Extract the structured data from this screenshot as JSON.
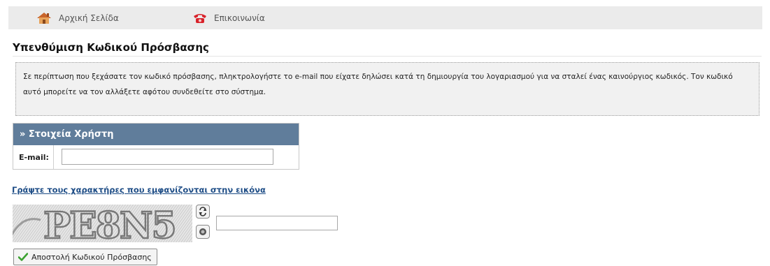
{
  "nav": {
    "home_label": "Αρχική Σελίδα",
    "contact_label": "Επικοινωνία",
    "home_icon": "home-icon",
    "contact_icon": "phone-icon"
  },
  "page": {
    "title": "Υπενθύμιση Κωδικού Πρόσβασης"
  },
  "notice": {
    "text": "Σε περίπτωση που ξεχάσατε τον κωδικό πρόσβασης, πληκτρολογήστε το e-mail που είχατε δηλώσει κατά τη δημιουργία του λογαριασμού για να σταλεί ένας καινούργιος κωδικός. Τον κωδικό αυτό μπορείτε να τον αλλάξετε αφότου συνδεθείτε στο σύστημα."
  },
  "user_box": {
    "heading": "» Στοιχεία Χρήστη",
    "email_label": "E-mail:",
    "email_value": ""
  },
  "captcha": {
    "heading": "Γράψτε τους χαρακτήρες που εμφανίζονται στην εικόνα",
    "image_text": "PE8N5",
    "input_value": "",
    "refresh_icon": "refresh-icon",
    "audio_icon": "audio-icon"
  },
  "submit": {
    "label": "Αποστολή Κωδικού Πρόσβασης",
    "icon": "checkmark-icon"
  },
  "colors": {
    "nav_bg": "#ebebeb",
    "box_header_bg": "#607d9b",
    "link": "#1f4e87",
    "notice_bg": "#f1f1f1",
    "check_green": "#3aa12f"
  }
}
